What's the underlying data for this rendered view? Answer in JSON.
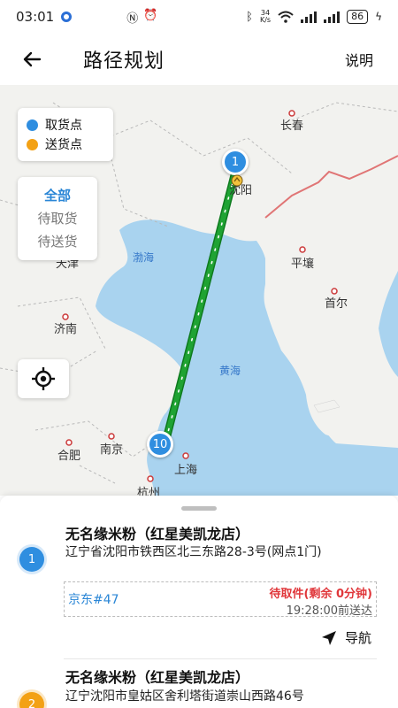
{
  "status_bar": {
    "time": "03:01",
    "net_speed_value": "34",
    "net_speed_unit": "K/s",
    "battery": "86"
  },
  "header": {
    "title": "路径规划",
    "help_label": "说明"
  },
  "map": {
    "legend": [
      {
        "label": "取货点",
        "color": "#2f8ee0"
      },
      {
        "label": "送货点",
        "color": "#f3a115"
      }
    ],
    "filters": [
      {
        "label": "全部",
        "active": true
      },
      {
        "label": "待取货",
        "active": false
      },
      {
        "label": "待送货",
        "active": false
      }
    ],
    "cities": {
      "changchun": "长春",
      "shenyang": "沈阳",
      "tianjin": "天津",
      "pyongyang": "平壤",
      "seoul": "首尔",
      "jinan": "济南",
      "hefei": "合肥",
      "nanjing": "南京",
      "shanghai": "上海",
      "hangzhou": "杭州"
    },
    "seas": {
      "bohai": "渤海",
      "yellow_sea": "黄海"
    },
    "markers": [
      {
        "label": "1"
      },
      {
        "label": "10"
      }
    ],
    "route_color": "#1fa333"
  },
  "orders": [
    {
      "number": "1",
      "store": "无名缘米粉（红星美凯龙店）",
      "address": "辽宁省沈阳市铁西区北三东路28-3号(网点1门)",
      "order_id": "京东#47",
      "status": "待取件(剩余 0分钟)",
      "deadline": "19:28:00前送达",
      "nav_label": "导航"
    },
    {
      "number": "2",
      "store": "无名缘米粉（红星美凯龙店）",
      "address": "辽宁沈阳市皇姑区舍利塔街道崇山西路46号"
    }
  ]
}
